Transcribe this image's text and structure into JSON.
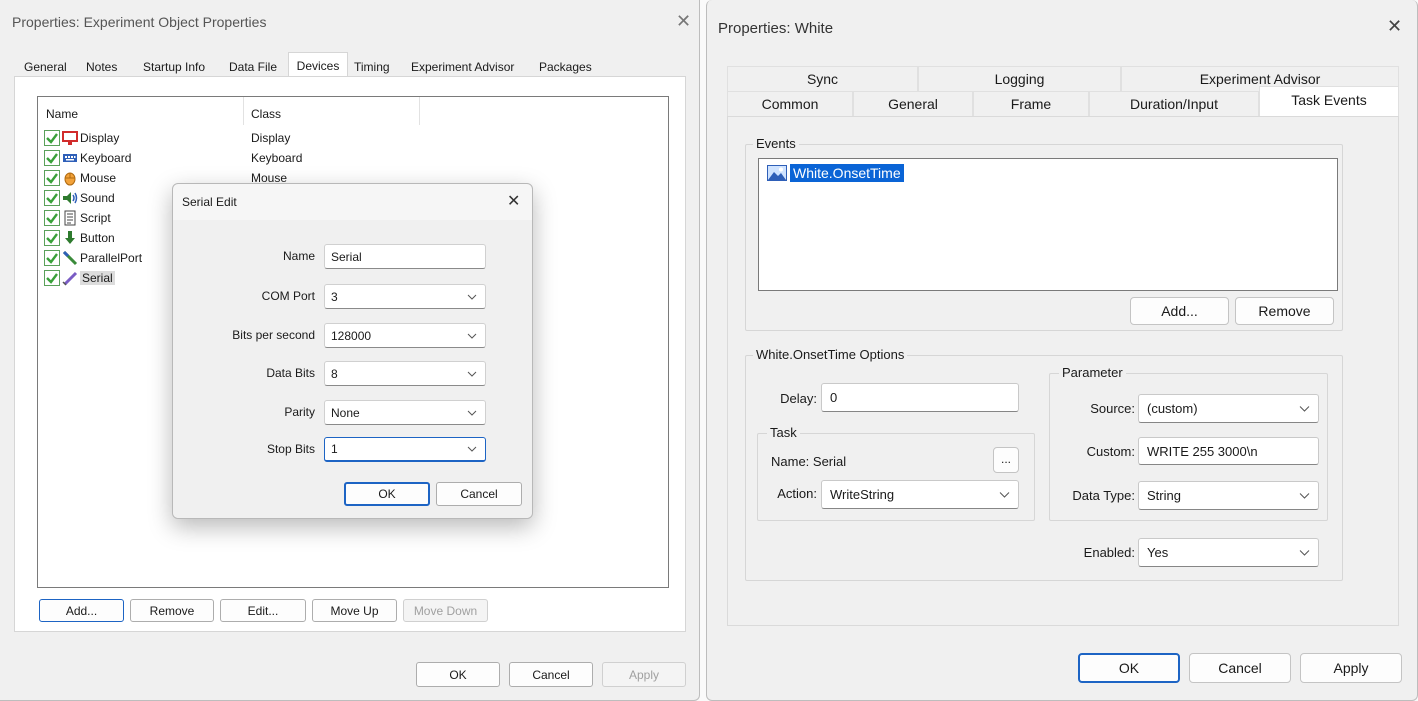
{
  "left_window": {
    "title": "Properties: Experiment Object Properties",
    "tabs": [
      "General",
      "Notes",
      "Startup Info",
      "Data File",
      "Devices",
      "Timing",
      "Experiment Advisor",
      "Packages"
    ],
    "active_tab": "Devices",
    "columns": [
      "Name",
      "Class"
    ],
    "devices": [
      {
        "name": "Display",
        "class": "Display",
        "icon": "display-icon"
      },
      {
        "name": "Keyboard",
        "class": "Keyboard",
        "icon": "keyboard-icon"
      },
      {
        "name": "Mouse",
        "class": "Mouse",
        "icon": "mouse-icon"
      },
      {
        "name": "Sound",
        "class": "",
        "icon": "speaker-icon"
      },
      {
        "name": "Script",
        "class": "",
        "icon": "script-icon"
      },
      {
        "name": "Button",
        "class": "",
        "icon": "button-icon"
      },
      {
        "name": "ParallelPort",
        "class": "",
        "icon": "parallel-port-icon"
      },
      {
        "name": "Serial",
        "class": "",
        "icon": "serial-icon"
      }
    ],
    "buttons": {
      "add": "Add...",
      "remove": "Remove",
      "edit": "Edit...",
      "move_up": "Move Up",
      "move_down": "Move Down"
    },
    "footer": {
      "ok": "OK",
      "cancel": "Cancel",
      "apply": "Apply"
    }
  },
  "serial_dialog": {
    "title": "Serial Edit",
    "fields": {
      "name": {
        "label": "Name",
        "value": "Serial"
      },
      "com_port": {
        "label": "COM Port",
        "value": "3"
      },
      "bits_per_second": {
        "label": "Bits per second",
        "value": "128000"
      },
      "data_bits": {
        "label": "Data Bits",
        "value": "8"
      },
      "parity": {
        "label": "Parity",
        "value": "None"
      },
      "stop_bits": {
        "label": "Stop Bits",
        "value": "1"
      }
    },
    "ok": "OK",
    "cancel": "Cancel"
  },
  "right_window": {
    "title": "Properties: White",
    "tabs_row1": [
      "Sync",
      "Logging",
      "Experiment Advisor"
    ],
    "tabs_row2": [
      "Common",
      "General",
      "Frame",
      "Duration/Input",
      "Task Events"
    ],
    "active_tab": "Task Events",
    "events_label": "Events",
    "events": [
      "White.OnsetTime"
    ],
    "add": "Add...",
    "remove": "Remove",
    "options_label": "White.OnsetTime Options",
    "delay_label": "Delay:",
    "delay_value": "0",
    "task_label": "Task",
    "task_name": "Name: Serial",
    "browse": "...",
    "action_label": "Action:",
    "action_value": "WriteString",
    "parameter_label": "Parameter",
    "source_label": "Source:",
    "source_value": "(custom)",
    "custom_label": "Custom:",
    "custom_value": "WRITE 255 3000\\n",
    "data_type_label": "Data Type:",
    "data_type_value": "String",
    "enabled_label": "Enabled:",
    "enabled_value": "Yes",
    "footer": {
      "ok": "OK",
      "cancel": "Cancel",
      "apply": "Apply"
    }
  }
}
